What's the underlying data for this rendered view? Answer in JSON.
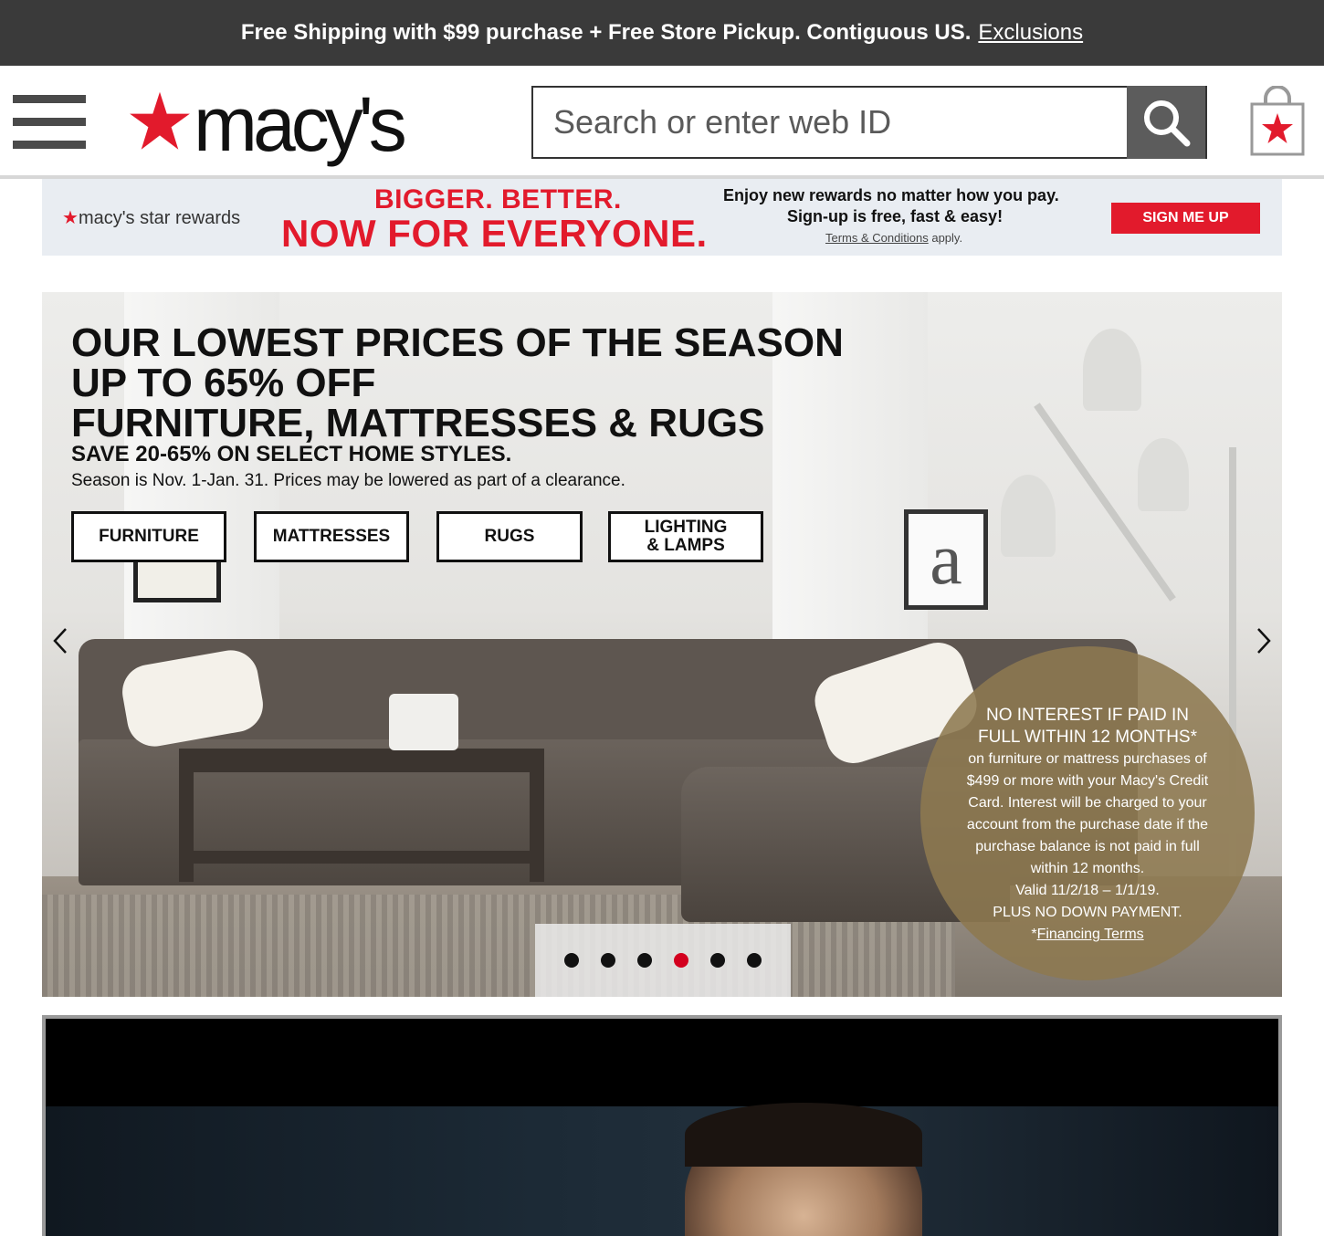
{
  "shipping_banner": {
    "text": "Free Shipping with $99 purchase + Free Store Pickup. Contiguous US.",
    "link": "Exclusions"
  },
  "header": {
    "logo_text": "macy's",
    "search_placeholder": "Search or enter web ID",
    "icons": [
      "menu-icon",
      "search-icon",
      "shopping-bag-icon"
    ]
  },
  "rewards_banner": {
    "brand": "macy's star rewards",
    "headline_1": "BIGGER. BETTER.",
    "headline_2": "NOW FOR EVERYONE.",
    "message_1": "Enjoy new rewards no matter how you pay.",
    "message_2": "Sign-up is free, fast & easy!",
    "terms_link": "Terms & Conditions",
    "terms_suffix": "apply.",
    "button": "SIGN ME UP",
    "accent_color": "#e21a2c"
  },
  "hero": {
    "headline_line_1": "OUR LOWEST PRICES OF THE SEASON",
    "headline_line_2": "UP TO 65% OFF",
    "headline_line_3": "FURNITURE, MATTRESSES & RUGS",
    "subhead": "SAVE 20-65% ON SELECT HOME STYLES.",
    "note": "Season is Nov. 1-Jan. 31. Prices may be lowered as part of a clearance.",
    "buttons": [
      {
        "label": "FURNITURE"
      },
      {
        "label": "MATTRESSES"
      },
      {
        "label": "RUGS"
      },
      {
        "label_line_1": "LIGHTING",
        "label_line_2": "& LAMPS"
      }
    ],
    "art_letter": "a",
    "promo": {
      "line_1": "NO INTEREST IF PAID IN",
      "line_2": "FULL WITHIN 12 MONTHS*",
      "line_3": "on furniture or mattress purchases of",
      "line_4": "$499 or more with your Macy's Credit",
      "line_5": "Card. Interest will be charged to your",
      "line_6": "account from the purchase date if the",
      "line_7": "purchase balance is not paid in full",
      "line_8": "within 12 months.",
      "line_9": "Valid 11/2/18 – 1/1/19.",
      "line_10": "PLUS NO DOWN PAYMENT.",
      "footnote_mark": "*",
      "link": "Financing Terms"
    },
    "carousel": {
      "slide_count": 6,
      "active_index": 3
    }
  },
  "video": {
    "icons": [
      "video-player"
    ]
  },
  "colors": {
    "brand_red": "#e21a2c",
    "banner_dark": "#3a3a3a",
    "active_dot": "#d3001e"
  }
}
